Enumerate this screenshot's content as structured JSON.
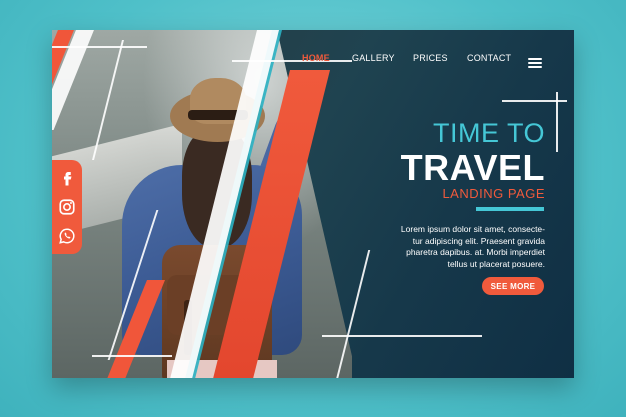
{
  "nav": {
    "items": [
      {
        "label": "HOME",
        "active": true
      },
      {
        "label": "GALLERY",
        "active": false
      },
      {
        "label": "PRICES",
        "active": false
      },
      {
        "label": "CONTACT",
        "active": false
      }
    ],
    "menu_icon": "hamburger-menu-icon"
  },
  "social": {
    "icons": [
      "facebook-icon",
      "instagram-icon",
      "whatsapp-icon"
    ],
    "color": "#f05a3c"
  },
  "hero": {
    "subtitle": "TIME TO",
    "title": "TRAVEL",
    "kicker": "LANDING PAGE",
    "body_lines": [
      "Lorem ipsum dolor sit amet, consecte-",
      "tur adipiscing elit. Praesent gravida",
      "pharetra dapibus. at. Morbi imperdiet",
      "tellus ut placerat posuere."
    ],
    "cta_label": "SEE MORE"
  },
  "colors": {
    "accent": "#f05a3c",
    "teal": "#45c7d6",
    "background": "#4fc0c9",
    "panel": "#1f4350"
  }
}
